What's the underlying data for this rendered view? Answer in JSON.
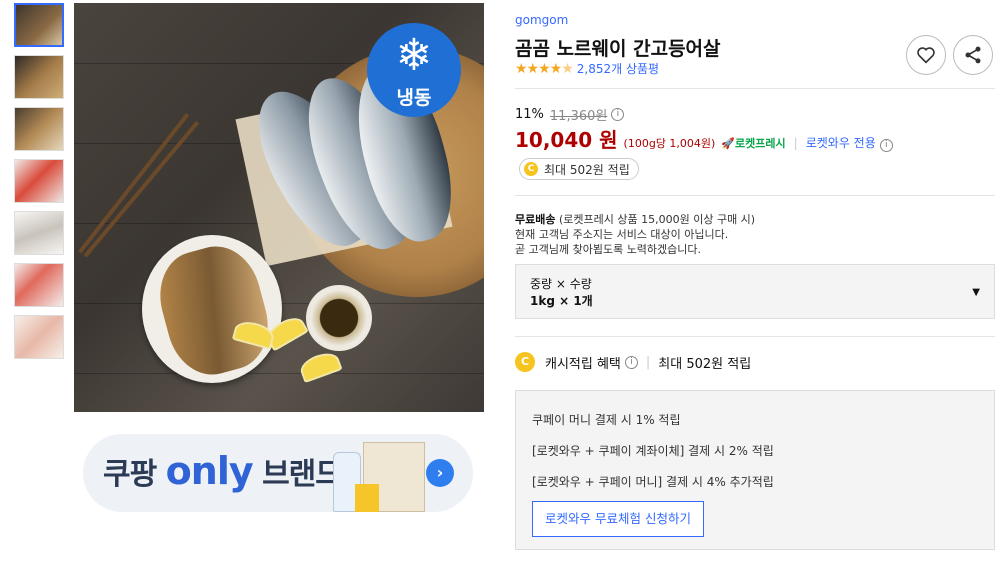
{
  "gallery": {
    "badge_text": "냉동",
    "thumbnails": [
      {
        "name": "thumb-main",
        "color": "#5a4d40"
      },
      {
        "name": "thumb-fried",
        "color": "#8a6a45"
      },
      {
        "name": "thumb-plate",
        "color": "#9a7a55"
      },
      {
        "name": "thumb-package",
        "color": "#e7e0dc"
      },
      {
        "name": "thumb-fillets",
        "color": "#d9d5cf"
      },
      {
        "name": "thumb-package2",
        "color": "#efe7e4"
      },
      {
        "name": "thumb-label",
        "color": "#f1ebe3"
      }
    ]
  },
  "promo": {
    "prefix": "쿠팡",
    "only": "only",
    "suffix": "브랜드"
  },
  "product": {
    "brand": "gomgom",
    "title": "곰곰 노르웨이 간고등어살",
    "rating": 4.5,
    "review_count": "2,852개 상품평",
    "discount_rate": "11%",
    "original_price": "11,360원",
    "price": "10,040 원",
    "unit_price": "(100g당 1,004원)",
    "rocket_label": "로켓프레시",
    "wow_label": "로켓와우 전용",
    "cashback_pill": "최대 502원 적립"
  },
  "shipping": {
    "title": "무료배송",
    "condition": "(로켓프레시 상품 15,000원 이상 구매 시)",
    "line2": "현재 고객님 주소지는 서비스 대상이 아닙니다.",
    "line3": "곧 고객님께 찾아뵙도록 노력하겠습니다."
  },
  "option": {
    "label": "중량 × 수량",
    "value": "1kg × 1개"
  },
  "cash": {
    "title": "캐시적립 혜택",
    "max": "최대 502원 적립",
    "lines": [
      "쿠페이 머니 결제 시 1% 적립",
      "[로켓와우 + 쿠페이 계좌이체] 결제 시 2% 적립",
      "[로켓와우 + 쿠페이 머니] 결제 시 4% 추가적립"
    ],
    "cta": "로켓와우 무료체험 신청하기"
  },
  "icons": [
    "heart-icon",
    "share-icon",
    "snowflake-icon",
    "info-icon",
    "coin-icon",
    "caret-down-icon",
    "arrow-right-icon",
    "rocket-icon"
  ]
}
